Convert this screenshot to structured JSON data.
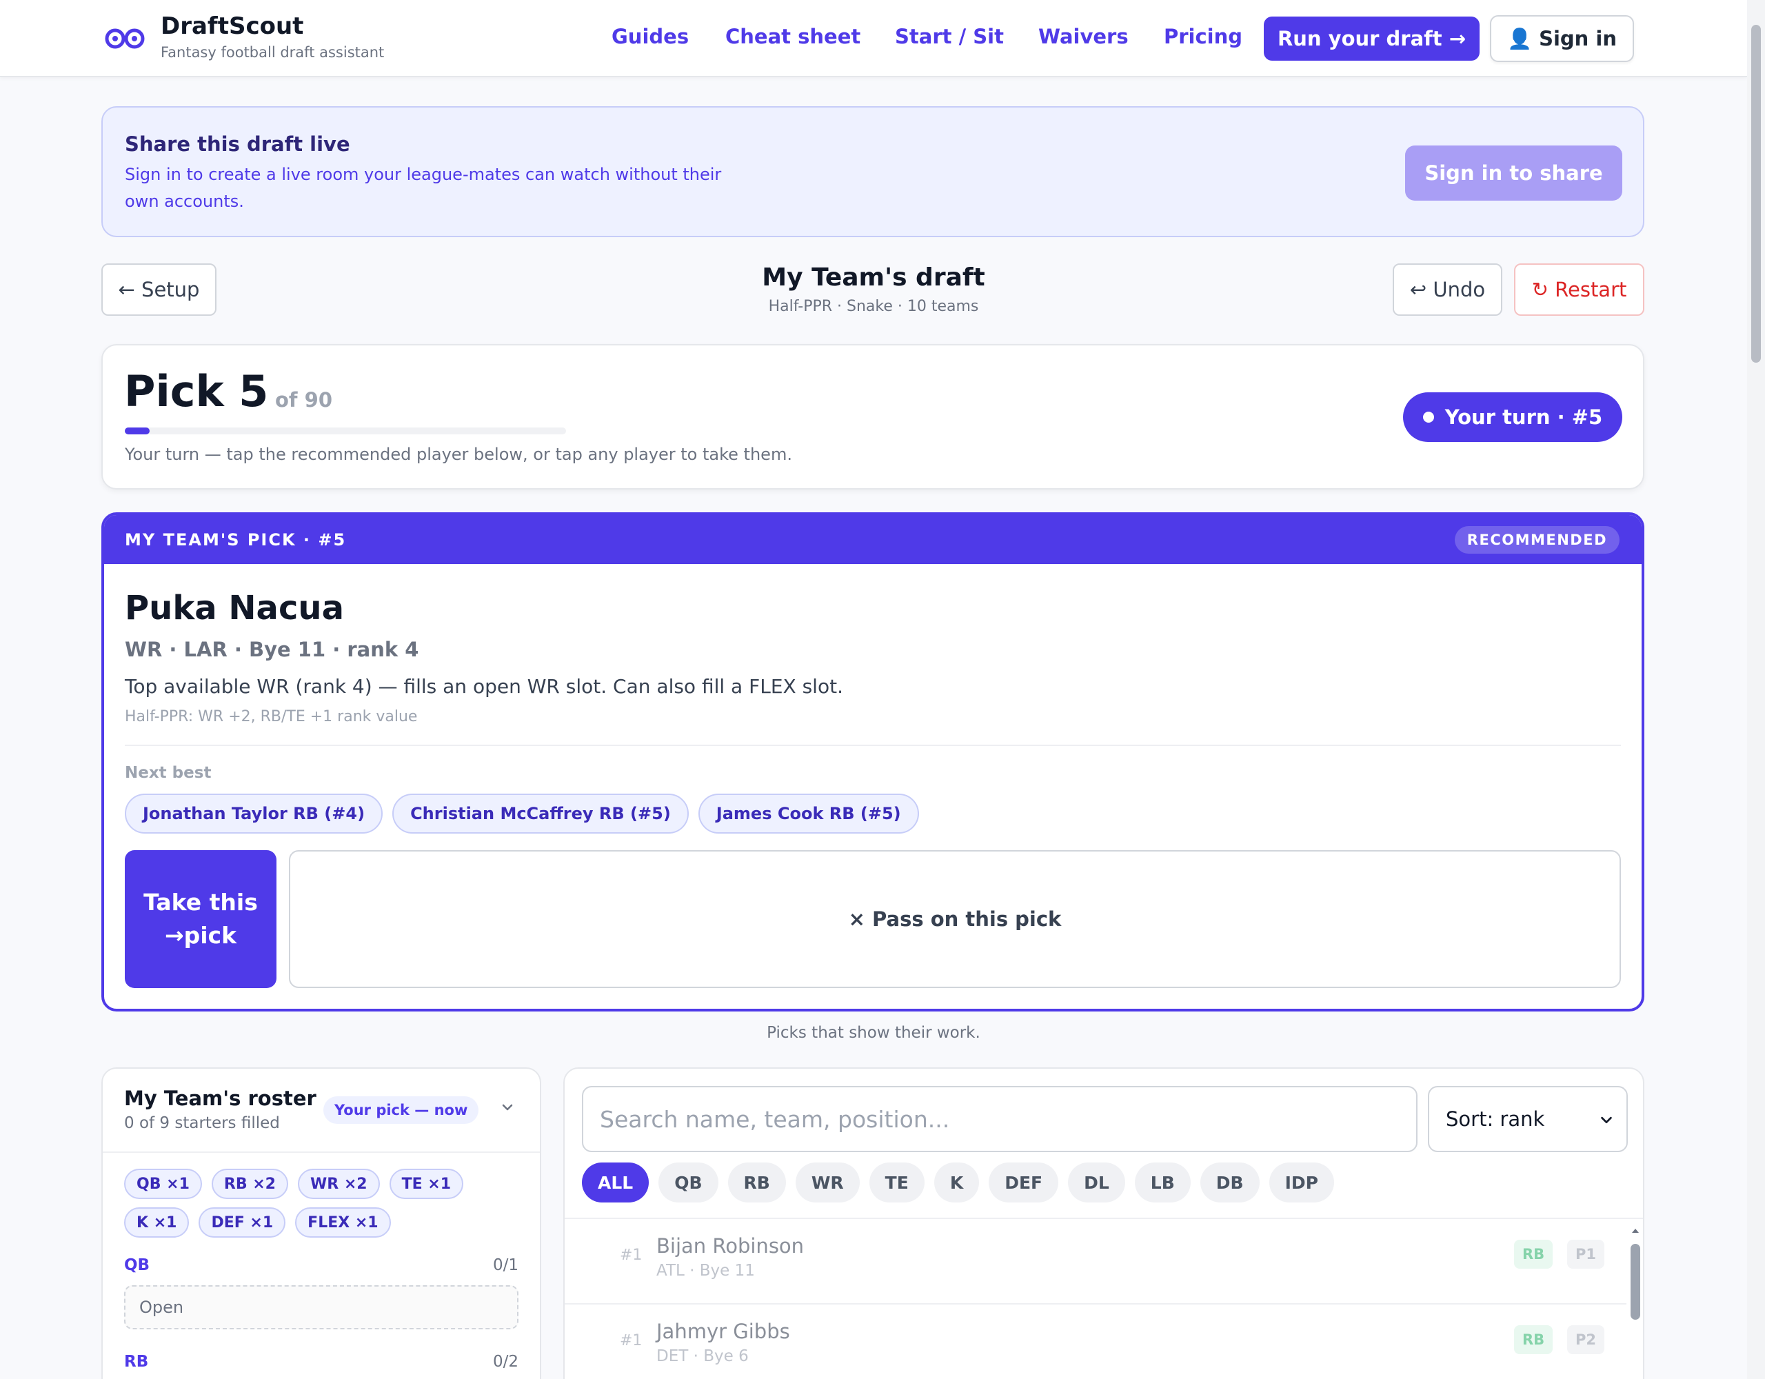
{
  "brand": {
    "name": "DraftScout",
    "tagline": "Fantasy football draft assistant"
  },
  "nav": {
    "links": [
      "Guides",
      "Cheat sheet",
      "Start / Sit",
      "Waivers",
      "Pricing"
    ],
    "cta": "Run your draft →",
    "signin": "Sign in",
    "signin_icon": "user-icon"
  },
  "share": {
    "title": "Share this draft live",
    "description": "Sign in to create a live room your league-mates can watch without their own accounts.",
    "button": "Sign in to share"
  },
  "draft": {
    "setup_button": "← Setup",
    "title": "My Team's draft",
    "subtitle": "Half-PPR · Snake · 10 teams",
    "undo_button": "↩ Undo",
    "restart_button": "↻ Restart"
  },
  "pick": {
    "label": "Pick 5",
    "of": "of 90",
    "progress_fraction": 0.0556,
    "hint": "Your turn — tap the recommended player below, or tap any player to take them.",
    "turn_pill": "Your turn · #5"
  },
  "recommendation": {
    "header": "MY TEAM'S PICK · #5",
    "badge": "RECOMMENDED",
    "player_name": "Puka Nacua",
    "meta": "WR · LAR · Bye 11 · rank 4",
    "reason": "Top available WR (rank 4) — fills an open WR slot. Can also fill a FLEX slot.",
    "note": "Half-PPR: WR +2, RB/TE +1 rank value",
    "next_best_label": "Next best",
    "next_best": [
      "Jonathan Taylor RB (#4)",
      "Christian McCaffrey RB (#5)",
      "James Cook RB (#5)"
    ],
    "take_button": "Take this →pick",
    "pass_button": "× Pass on this pick"
  },
  "tagline": "Picks that show their work.",
  "roster": {
    "title": "My Team's roster",
    "subtitle": "0 of 9 starters filled",
    "pill": "Your pick — now",
    "slot_chips": [
      "QB ×1",
      "RB ×2",
      "WR ×2",
      "TE ×1",
      "K ×1",
      "DEF ×1",
      "FLEX ×1"
    ],
    "positions": [
      {
        "label": "QB",
        "count": "0/1",
        "slot": "Open"
      },
      {
        "label": "RB",
        "count": "0/2"
      }
    ]
  },
  "board": {
    "search_placeholder": "Search name, team, position...",
    "sort": "Sort: rank",
    "filters": [
      "ALL",
      "QB",
      "RB",
      "WR",
      "TE",
      "K",
      "DEF",
      "DL",
      "LB",
      "DB",
      "IDP"
    ],
    "active_filter": "ALL",
    "players": [
      {
        "rank": "#1",
        "name": "Bijan Robinson",
        "team": "ATL · Bye 11",
        "pos": "RB",
        "tier": "P1"
      },
      {
        "rank": "#1",
        "name": "Jahmyr Gibbs",
        "team": "DET · Bye 6",
        "pos": "RB",
        "tier": "P2"
      }
    ]
  },
  "colors": {
    "accent": "#4f3ae8",
    "accent_light": "#eef1ff",
    "danger": "#dc2626",
    "rb_badge": "#86d3aa"
  }
}
